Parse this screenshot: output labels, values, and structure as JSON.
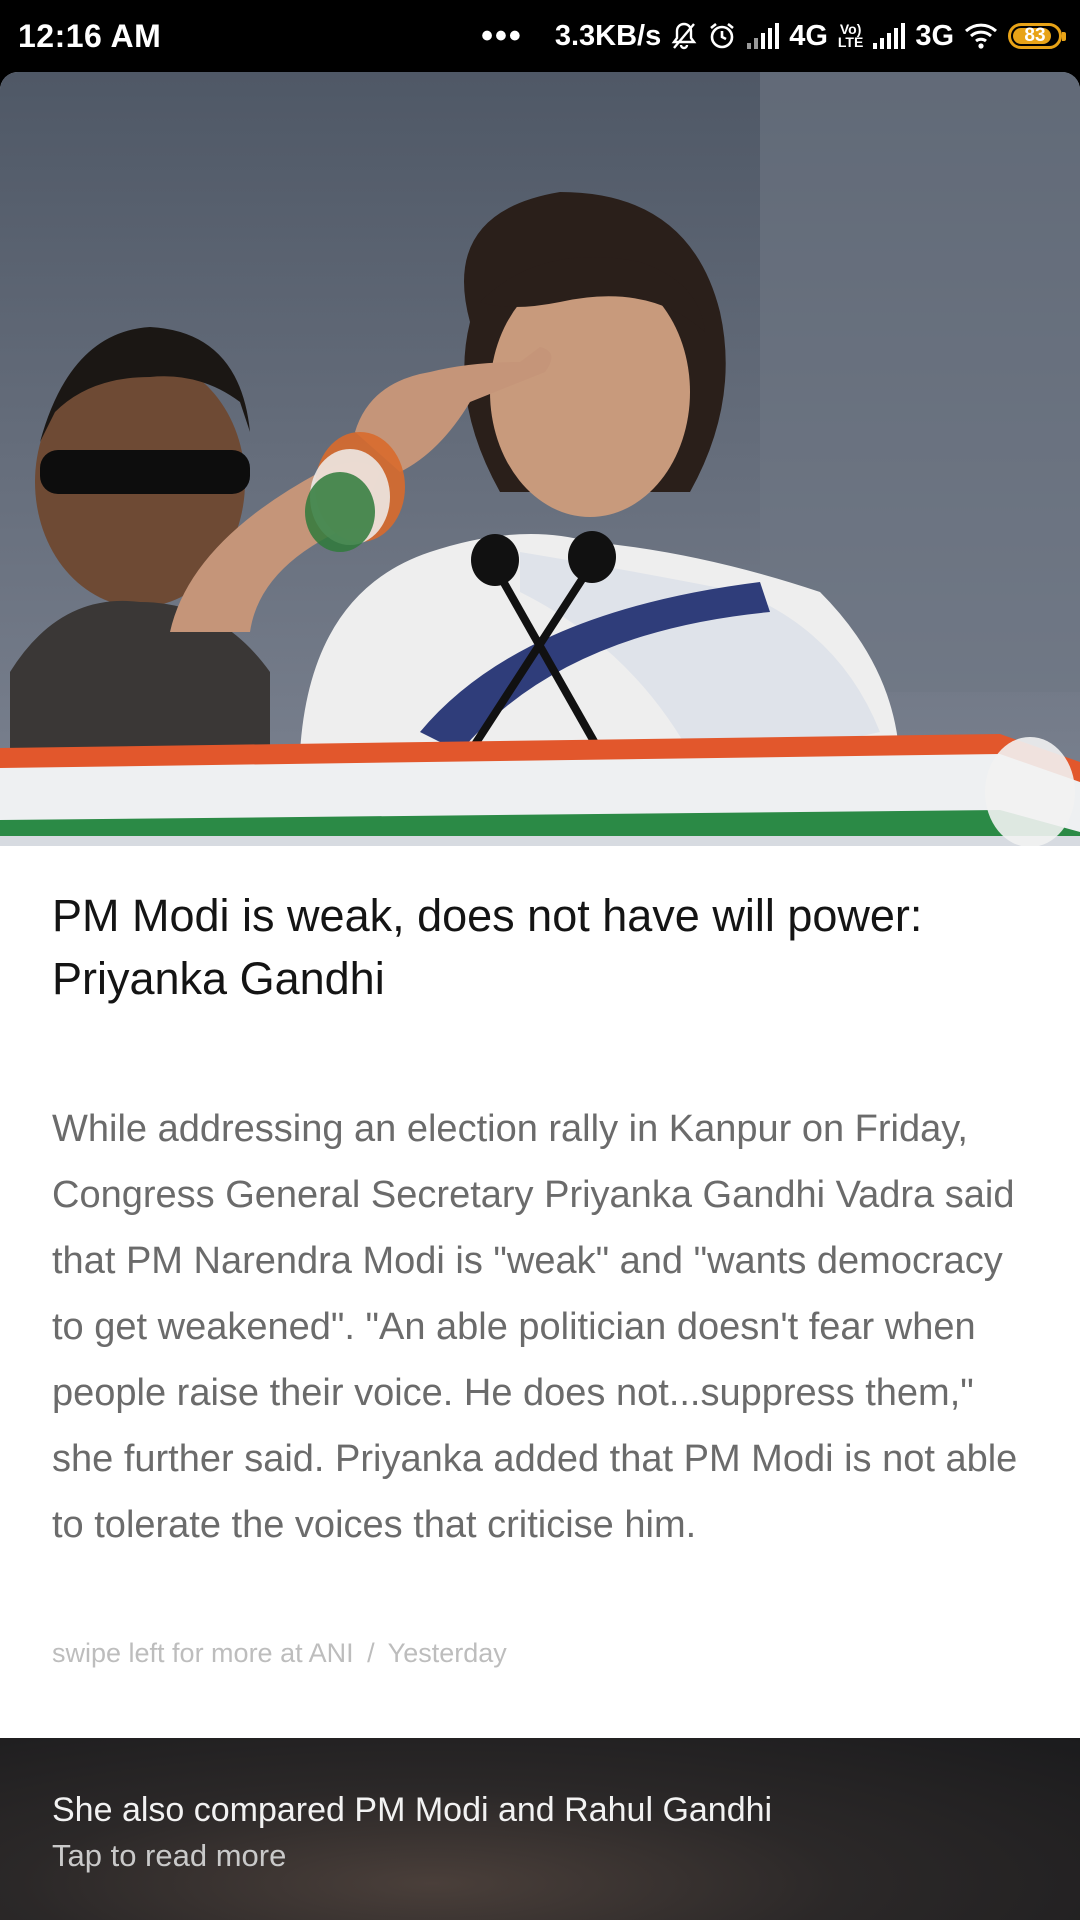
{
  "status_bar": {
    "time": "12:16 AM",
    "more": "•••",
    "network_speed": "3.3KB/s",
    "network_1": "4G",
    "volte": "Vo)\nLTE",
    "network_2": "3G",
    "battery": "83"
  },
  "article": {
    "image_alt": "Priyanka Gandhi speaking at a rally",
    "headline": "PM Modi is weak, does not have will power: Priyanka Gandhi",
    "body": "While addressing an election rally in Kanpur on Friday, Congress General Secretary Priyanka Gandhi Vadra said that PM Narendra Modi is \"weak\" and \"wants democracy to get weakened\". \"An able politician doesn't fear when people raise their voice. He does not...suppress them,\" she further said. Priyanka added that PM Modi is not able to tolerate the voices that criticise him.",
    "source_prefix": "swipe left for more at",
    "source_name": "ANI",
    "separator": "/",
    "time_ago": "Yesterday"
  },
  "footer": {
    "title": "She also compared PM Modi and Rahul Gandhi",
    "subtitle": "Tap to read more"
  },
  "colors": {
    "battery": "#e8a317",
    "headline": "#141414",
    "body": "#6b6b6b",
    "source": "#bdbdbd"
  }
}
